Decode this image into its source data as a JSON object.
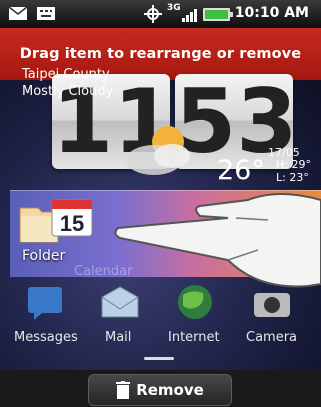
{
  "status_bar": {
    "time": "10:10 AM",
    "icons": [
      "mail-icon",
      "keyboard-icon",
      "gps-icon",
      "3g-icon",
      "signal-icon",
      "battery-icon"
    ],
    "network_label": "3G"
  },
  "banner": {
    "text": "Drag item to rearrange or remove"
  },
  "clock": {
    "hour": "11",
    "minute": "53"
  },
  "weather": {
    "location": "Taipei County",
    "condition": "Mostly Cloudy",
    "date": "17/05",
    "temperature": "26°",
    "high": "H: 29°",
    "low": "L: 23°"
  },
  "selected_item": {
    "label": "Folder",
    "calendar_day": "15",
    "ghost_label": "Calendar"
  },
  "dock": [
    {
      "label": "Messages"
    },
    {
      "label": "Mail"
    },
    {
      "label": "Internet"
    },
    {
      "label": "Camera"
    }
  ],
  "bottom_bar": {
    "remove_label": "Remove"
  },
  "colors": {
    "banner": "#b52116",
    "status_bg": "#1a1a1a"
  }
}
